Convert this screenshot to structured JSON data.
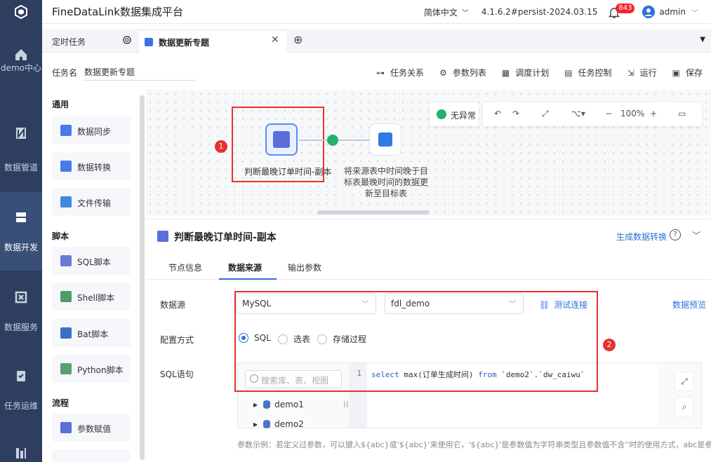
{
  "app": {
    "title": "FineDataLink数据集成平台",
    "language": "简体中文",
    "version": "4.1.6.2#persist-2024.03.15",
    "notification_count": "843",
    "user": "admin"
  },
  "leftnav": {
    "items": [
      {
        "label": "demo中心",
        "icon": "home-icon"
      },
      {
        "label": "数据管道",
        "icon": "pipeline-icon"
      },
      {
        "label": "数据开发",
        "icon": "database-icon",
        "active": true
      },
      {
        "label": "数据服务",
        "icon": "service-icon"
      },
      {
        "label": "任务运维",
        "icon": "clipboard-icon"
      }
    ]
  },
  "tabs": {
    "tab1": "定时任务",
    "tab2": "数据更新专题"
  },
  "task": {
    "label": "任务名",
    "name": "数据更新专题",
    "toolbar": [
      "任务关系",
      "参数列表",
      "调度计划",
      "任务控制",
      "运行",
      "保存"
    ]
  },
  "palette": {
    "sections": [
      {
        "title": "通用",
        "items": [
          "数据同步",
          "数据转换",
          "文件传输"
        ]
      },
      {
        "title": "脚本",
        "items": [
          "SQL脚本",
          "Shell脚本",
          "Bat脚本",
          "Python脚本"
        ]
      },
      {
        "title": "流程",
        "items": [
          "参数赋值"
        ]
      }
    ]
  },
  "canvas": {
    "status": "无异常",
    "zoom": "100%",
    "node1": "判断最晚订单时间-副本",
    "node2_lines": [
      "将来源表中时间晚于目",
      "标表最晚时间的数据更",
      "新至目标表"
    ],
    "marker1": "1",
    "marker2": "2"
  },
  "panel": {
    "title": "判断最晚订单时间-副本",
    "gen_link": "生成数据转换",
    "subtabs": [
      "节点信息",
      "数据来源",
      "输出参数"
    ],
    "datasource_label": "数据源",
    "datasource_type": "MySQL",
    "datasource_conn": "fdl_demo",
    "test_link": "测试连接",
    "preview_link": "数据预览",
    "config_label": "配置方式",
    "config_options": [
      "SQL",
      "选表",
      "存储过程"
    ],
    "sql_label": "SQL语句",
    "search_placeholder": "搜索库、表、视图",
    "tree": [
      "demo1",
      "demo2"
    ],
    "line_no": "1",
    "code_kw1": "select",
    "code_mid": " max(订单生成时间) ",
    "code_kw2": "from",
    "code_rest": " `demo2`.`dw_caiwu`",
    "hint": "参数示例：若定义过参数，可以键入${abc}或'${abc}'来使用它，'${abc}'是参数值为字符串类型且参数值不含''时的使用方式，abc是参数名。"
  }
}
